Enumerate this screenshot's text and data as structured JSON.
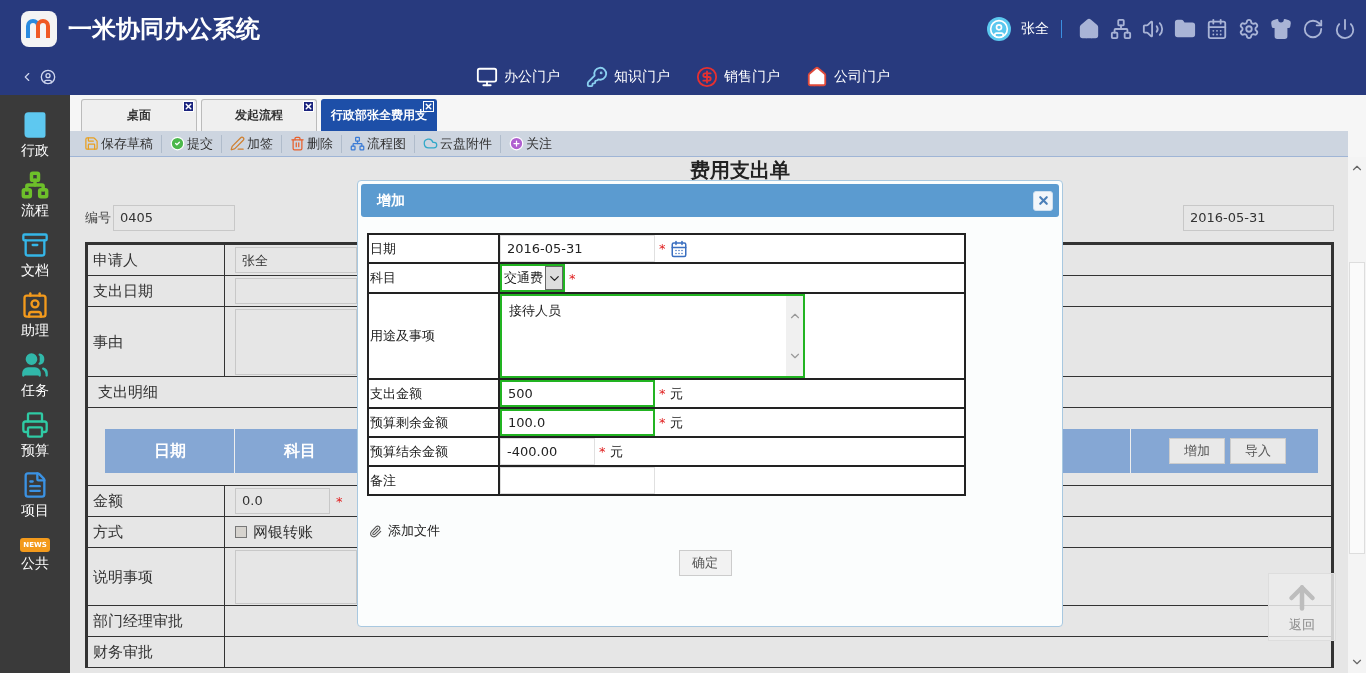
{
  "app": {
    "title": "一米协同办公系统"
  },
  "user": {
    "name": "张全"
  },
  "portals": [
    {
      "label": "办公门户",
      "kind": "monitor"
    },
    {
      "label": "知识门户",
      "kind": "key"
    },
    {
      "label": "销售门户",
      "kind": "dollar"
    },
    {
      "label": "公司门户",
      "kind": "house"
    }
  ],
  "sidebar": {
    "items": [
      {
        "label": "行政",
        "kind": "book"
      },
      {
        "label": "流程",
        "kind": "flow"
      },
      {
        "label": "文档",
        "kind": "archive"
      },
      {
        "label": "助理",
        "kind": "contact"
      },
      {
        "label": "任务",
        "kind": "users"
      },
      {
        "label": "预算",
        "kind": "register"
      },
      {
        "label": "项目",
        "kind": "file"
      },
      {
        "label": "公共",
        "kind": "news",
        "badge": "NEWS"
      }
    ]
  },
  "tabs": [
    {
      "label": "桌面",
      "selected": false
    },
    {
      "label": "发起流程",
      "selected": false
    },
    {
      "label": "行政部张全费用支",
      "selected": true
    }
  ],
  "toolbar": [
    {
      "label": "保存草稿",
      "kind": "save"
    },
    {
      "label": "提交",
      "kind": "submit"
    },
    {
      "label": "加签",
      "kind": "sign"
    },
    {
      "label": "删除",
      "kind": "delete"
    },
    {
      "label": "流程图",
      "kind": "flow"
    },
    {
      "label": "云盘附件",
      "kind": "cloud"
    },
    {
      "label": "关注",
      "kind": "follow"
    }
  ],
  "form": {
    "title": "费用支出单",
    "number_label": "编号",
    "number": "0405",
    "date": "2016-05-31",
    "rows": [
      {
        "kind": "field",
        "label": "申请人",
        "value": "张全"
      },
      {
        "kind": "field",
        "label": "支出日期"
      },
      {
        "kind": "textarea",
        "label": "事由"
      },
      {
        "kind": "section",
        "label": "支出明细"
      },
      {
        "kind": "detail",
        "columns": [
          "日期",
          "科目"
        ],
        "buttons": [
          "增加",
          "导入"
        ]
      },
      {
        "kind": "amount",
        "label": "金额",
        "value": "0.0",
        "required_mark": "*"
      },
      {
        "kind": "options",
        "label": "方式",
        "options": [
          {
            "label": "网银转账",
            "checked": false
          }
        ]
      },
      {
        "kind": "textarea",
        "label": "说明事项"
      },
      {
        "kind": "plain",
        "label": "部门经理审批"
      },
      {
        "kind": "plain",
        "label": "财务审批"
      }
    ]
  },
  "dialog": {
    "title": "增加",
    "rows": [
      {
        "kind": "date",
        "label": "日期",
        "value": "2016-05-31",
        "required_mark": "*",
        "validated": false
      },
      {
        "kind": "select",
        "label": "科目",
        "value": "交通费",
        "required_mark": "*",
        "validated": true
      },
      {
        "kind": "textarea",
        "label": "用途及事项",
        "value": "接待人员",
        "validated": true
      },
      {
        "kind": "input",
        "label": "支出金额",
        "value": "500",
        "required_mark": "*",
        "unit": "元",
        "validated": true
      },
      {
        "kind": "input",
        "label": "预算剩余金额",
        "value": "100.0",
        "required_mark": "*",
        "unit": "元",
        "validated": true
      },
      {
        "kind": "short",
        "label": "预算结余金额",
        "value": "-400.00",
        "required_mark": "*",
        "unit": "元",
        "validated": false
      },
      {
        "kind": "input",
        "label": "备注",
        "validated": false
      }
    ],
    "attach_label": "添加文件",
    "ok_label": "确定"
  },
  "back_to_top": "返回"
}
